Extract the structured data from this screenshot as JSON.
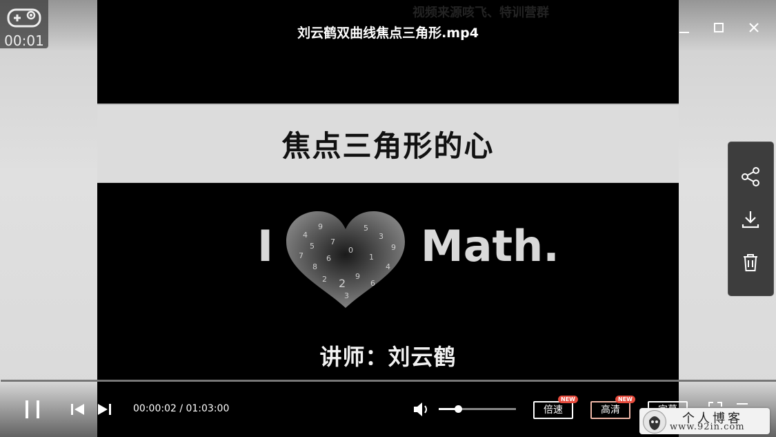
{
  "player": {
    "file_title": "刘云鹤双曲线焦点三角形.mp4",
    "watermark": "视频来源咳飞、特训营群",
    "overlay_timer": "00:01",
    "window_controls": {
      "minimize": "minimize-icon",
      "maximize": "maximize-icon",
      "close": "close-icon"
    },
    "side_actions": [
      "share-icon",
      "download-icon",
      "delete-icon"
    ]
  },
  "slide": {
    "title": "焦点三角形的心",
    "love_i": "I",
    "love_math": "Math.",
    "lecturer": "讲师：刘云鹤"
  },
  "controls": {
    "current_time": "00:00:02",
    "duration": "01:03:00",
    "time_display": "00:00:02 / 01:03:00",
    "progress": 0.0005,
    "volume": 0.25,
    "speed_label": "倍速",
    "speed_badge": "NEW",
    "quality_label": "高清",
    "quality_badge": "NEW",
    "subtitle_label": "字幕"
  },
  "site_logo": {
    "name": "个人博客",
    "url": "www.92in.com"
  }
}
